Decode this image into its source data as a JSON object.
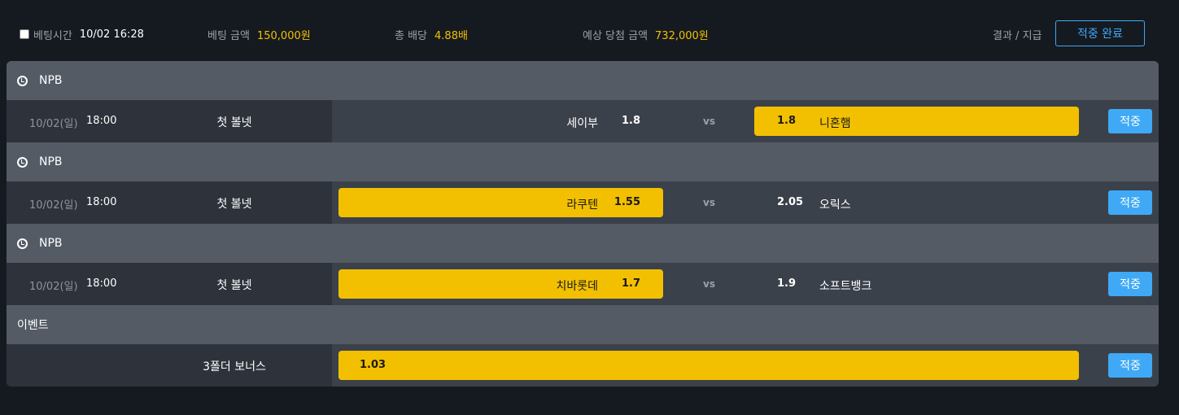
{
  "header": {
    "bet_time_label": "베팅시간",
    "bet_time_value": "10/02 16:28",
    "bet_amount_label": "베팅 금액",
    "bet_amount_value": "150,000원",
    "total_odds_label": "총 배당",
    "total_odds_value": "4.88배",
    "expected_win_label": "예상 당첨 금액",
    "expected_win_value": "732,000원",
    "result_label": "결과 / 지급",
    "complete_button": "적중 완료"
  },
  "colors": {
    "selected": "#f2c000",
    "accent": "#3fa9f5",
    "gold_text": "#f2c000"
  },
  "bets": [
    {
      "league": "NPB",
      "league_icon": "soccer-ball-icon",
      "date": "10/02(일)",
      "time": "18:00",
      "market": "첫 볼넷",
      "home_team": "세이부",
      "home_odds": "1.8",
      "vs": "vs",
      "away_odds": "1.8",
      "away_team": "니혼햄",
      "selected": "away",
      "result": "적중"
    },
    {
      "league": "NPB",
      "league_icon": "soccer-ball-icon",
      "date": "10/02(일)",
      "time": "18:00",
      "market": "첫 볼넷",
      "home_team": "라쿠텐",
      "home_odds": "1.55",
      "vs": "vs",
      "away_odds": "2.05",
      "away_team": "오릭스",
      "selected": "home",
      "result": "적중"
    },
    {
      "league": "NPB",
      "league_icon": "soccer-ball-icon",
      "date": "10/02(일)",
      "time": "18:00",
      "market": "첫 볼넷",
      "home_team": "치바롯데",
      "home_odds": "1.7",
      "vs": "vs",
      "away_odds": "1.9",
      "away_team": "소프트뱅크",
      "selected": "home",
      "result": "적중"
    }
  ],
  "event": {
    "title": "이벤트",
    "market": "3폴더 보너스",
    "odds": "1.03",
    "result": "적중"
  }
}
